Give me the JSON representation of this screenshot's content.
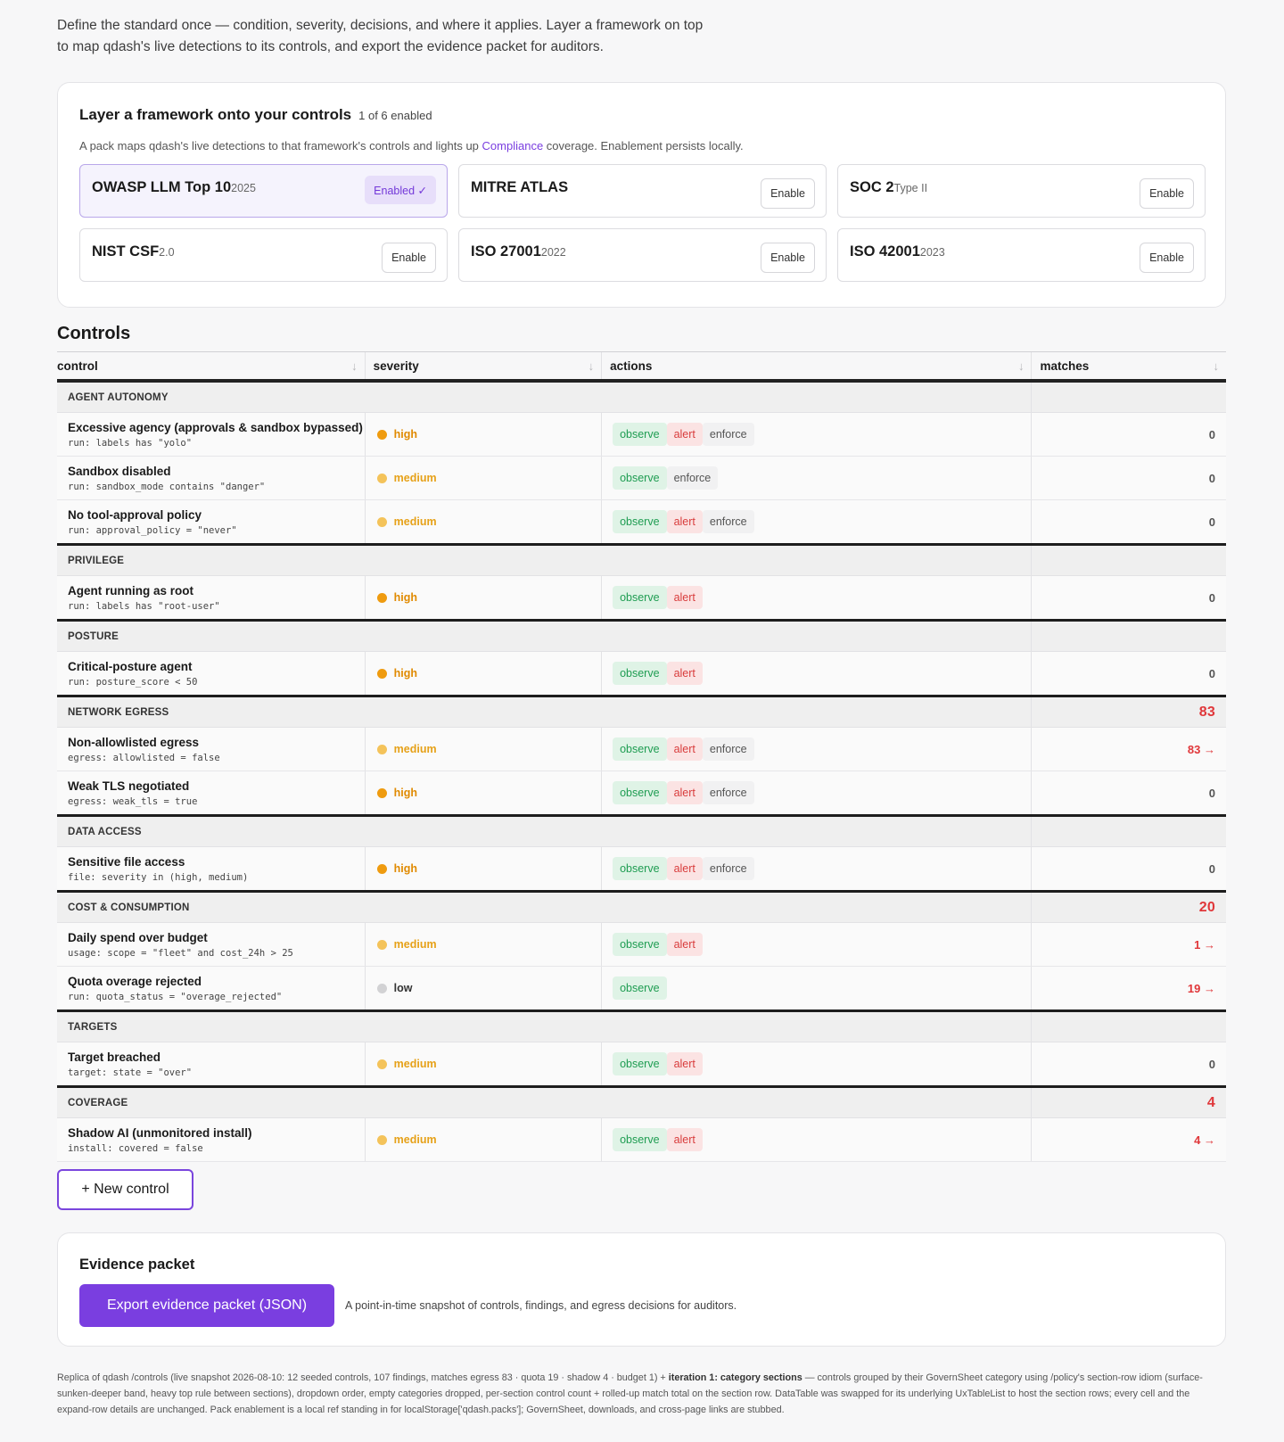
{
  "intro": {
    "line1": "Define the standard once — condition, severity, decisions, and where it applies. Layer a framework on top",
    "line2": "to map qdash's live detections to its controls, and export the evidence packet for auditors."
  },
  "frameworks": {
    "title": "Layer a framework onto your controls",
    "count": "1 of 6 enabled",
    "desc_before": "A pack maps qdash's live detections to that framework's controls and lights up ",
    "desc_link": "Compliance",
    "desc_after": " coverage. Enablement persists locally.",
    "packs": [
      {
        "name": "OWASP LLM Top 10",
        "version": "2025",
        "state": "Enabled ✓",
        "enabled": true
      },
      {
        "name": "MITRE ATLAS",
        "version": "",
        "state": "Enable",
        "enabled": false
      },
      {
        "name": "SOC 2",
        "version": "Type II",
        "state": "Enable",
        "enabled": false
      },
      {
        "name": "NIST CSF",
        "version": "2.0",
        "state": "Enable",
        "enabled": false
      },
      {
        "name": "ISO 27001",
        "version": "2022",
        "state": "Enable",
        "enabled": false
      },
      {
        "name": "ISO 42001",
        "version": "2023",
        "state": "Enable",
        "enabled": false
      }
    ]
  },
  "controls": {
    "title": "Controls",
    "columns": [
      "control",
      "severity",
      "actions",
      "matches"
    ],
    "sort_icon": "arrow-down-icon",
    "sections": [
      {
        "label": "AGENT AUTONOMY",
        "total": "",
        "rows": [
          {
            "name": "Excessive agency (approvals & sandbox bypassed)",
            "cond": "run: labels has \"yolo\"",
            "severity": "high",
            "actions": [
              "observe",
              "alert",
              "enforce"
            ],
            "matches": "0",
            "hot": false
          },
          {
            "name": "Sandbox disabled",
            "cond": "run: sandbox_mode contains \"danger\"",
            "severity": "medium",
            "actions": [
              "observe",
              "enforce"
            ],
            "matches": "0",
            "hot": false
          },
          {
            "name": "No tool-approval policy",
            "cond": "run: approval_policy = \"never\"",
            "severity": "medium",
            "actions": [
              "observe",
              "alert",
              "enforce"
            ],
            "matches": "0",
            "hot": false
          }
        ]
      },
      {
        "label": "PRIVILEGE",
        "total": "",
        "rows": [
          {
            "name": "Agent running as root",
            "cond": "run: labels has \"root-user\"",
            "severity": "high",
            "actions": [
              "observe",
              "alert"
            ],
            "matches": "0",
            "hot": false
          }
        ]
      },
      {
        "label": "POSTURE",
        "total": "",
        "rows": [
          {
            "name": "Critical-posture agent",
            "cond": "run: posture_score < 50",
            "severity": "high",
            "actions": [
              "observe",
              "alert"
            ],
            "matches": "0",
            "hot": false
          }
        ]
      },
      {
        "label": "NETWORK EGRESS",
        "total": "83",
        "rows": [
          {
            "name": "Non-allowlisted egress",
            "cond": "egress: allowlisted = false",
            "severity": "medium",
            "actions": [
              "observe",
              "alert",
              "enforce"
            ],
            "matches": "83 →",
            "hot": true
          },
          {
            "name": "Weak TLS negotiated",
            "cond": "egress: weak_tls = true",
            "severity": "high",
            "actions": [
              "observe",
              "alert",
              "enforce"
            ],
            "matches": "0",
            "hot": false
          }
        ]
      },
      {
        "label": "DATA ACCESS",
        "total": "",
        "rows": [
          {
            "name": "Sensitive file access",
            "cond": "file: severity in (high, medium)",
            "severity": "high",
            "actions": [
              "observe",
              "alert",
              "enforce"
            ],
            "matches": "0",
            "hot": false
          }
        ]
      },
      {
        "label": "COST & CONSUMPTION",
        "total": "20",
        "rows": [
          {
            "name": "Daily spend over budget",
            "cond": "usage: scope = \"fleet\" and cost_24h > 25",
            "severity": "medium",
            "actions": [
              "observe",
              "alert"
            ],
            "matches": "1 →",
            "hot": true
          },
          {
            "name": "Quota overage rejected",
            "cond": "run: quota_status = \"overage_rejected\"",
            "severity": "low",
            "actions": [
              "observe"
            ],
            "matches": "19 →",
            "hot": true
          }
        ]
      },
      {
        "label": "TARGETS",
        "total": "",
        "rows": [
          {
            "name": "Target breached",
            "cond": "target: state = \"over\"",
            "severity": "medium",
            "actions": [
              "observe",
              "alert"
            ],
            "matches": "0",
            "hot": false
          }
        ]
      },
      {
        "label": "COVERAGE",
        "total": "4",
        "rows": [
          {
            "name": "Shadow AI (unmonitored install)",
            "cond": "install: covered = false",
            "severity": "medium",
            "actions": [
              "observe",
              "alert"
            ],
            "matches": "4 →",
            "hot": true
          }
        ]
      }
    ],
    "new_button": "+ New control"
  },
  "evidence": {
    "title": "Evidence packet",
    "button": "Export evidence packet (JSON)",
    "note": "A point-in-time snapshot of controls, findings, and egress decisions for auditors."
  },
  "footnote": {
    "before": "Replica of qdash /controls (live snapshot 2026-08-10: 12 seeded controls, 107 findings, matches egress 83 · quota 19 · shadow 4 · budget 1) + ",
    "bold": "iteration 1: category sections",
    "after": " — controls grouped by their GovernSheet category using /policy's section-row idiom (surface-sunken-deeper band, heavy top rule between sections), dropdown order, empty categories dropped, per-section control count + rolled-up match total on the section row. DataTable was swapped for its underlying UxTableList to host the section rows; every cell and the expand-row details are unchanged. Pack enablement is a local ref standing in for localStorage['qdash.packs']; GovernSheet, downloads, and cross-page links are stubbed."
  }
}
